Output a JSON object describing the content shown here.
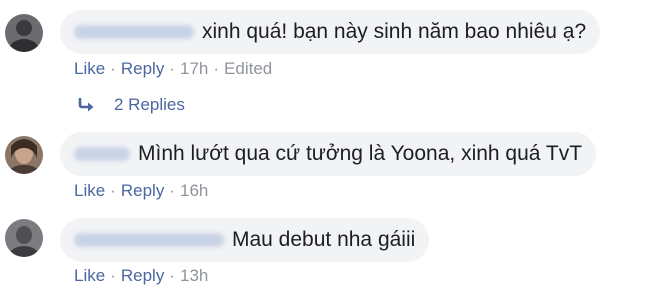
{
  "comments": [
    {
      "text": "xinh quá! bạn này sinh năm bao nhiêu ạ?",
      "like_label": "Like",
      "reply_label": "Reply",
      "time": "17h",
      "edited_label": "Edited",
      "avatar_color": "#4e4e52"
    },
    {
      "text": "Mình lướt qua cứ tưởng là Yoona, xinh quá TvT",
      "like_label": "Like",
      "reply_label": "Reply",
      "time": "16h",
      "avatar_color": "#6b5a4f"
    },
    {
      "text": "Mau debut nha gáiii",
      "like_label": "Like",
      "reply_label": "Reply",
      "time": "13h",
      "avatar_color": "#5a5b60"
    }
  ],
  "replies_toggle": {
    "label": "2 Replies",
    "icon": "reply-arrow-icon"
  },
  "colors": {
    "link": "#4b67a1",
    "meta": "#90949c",
    "bubble": "#f2f3f5",
    "text": "#1c1e21"
  }
}
